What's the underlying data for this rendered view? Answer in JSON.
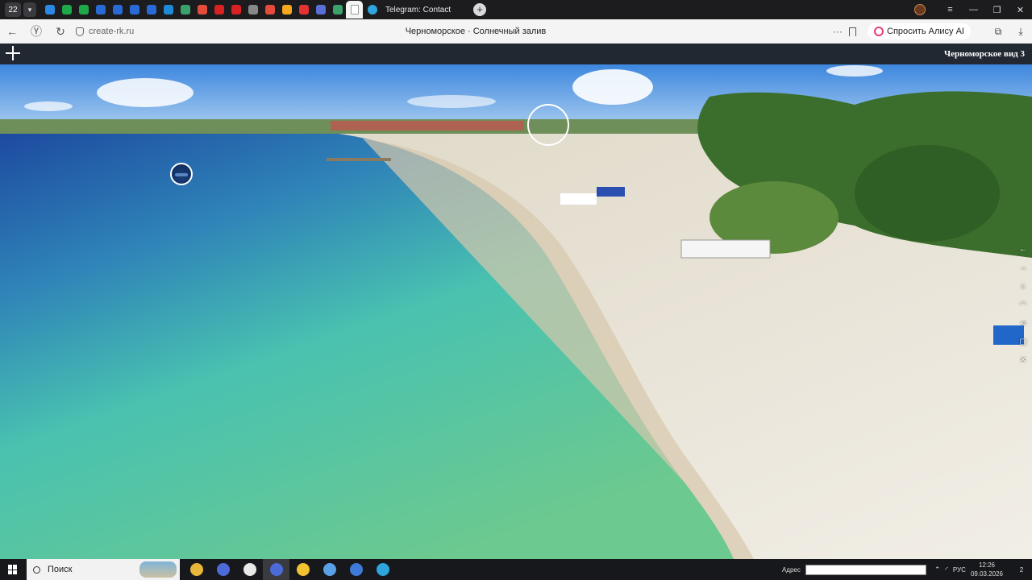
{
  "browser": {
    "tab_count": "22",
    "telegram_tab": "Telegram: Contact",
    "url": "create-rk.ru",
    "page_title": "Черноморское · Солнечный залив",
    "alice_button": "Спросить Алису AI"
  },
  "tab_icon_colors": [
    "#2b88e6",
    "#1fa84a",
    "#1fa84a",
    "#2a6ad6",
    "#2a6ad6",
    "#2a6ad6",
    "#2a6ad6",
    "#1e8ad6",
    "#3aa36b",
    "#e34b3b",
    "#d82222",
    "#d82222",
    "#888888",
    "#e34b3b",
    "#f6a81c",
    "#e33333",
    "#5b6dd6",
    "#3aa36b"
  ],
  "panorama": {
    "scene_name": "Черноморское вид 3"
  },
  "taskbar": {
    "search_placeholder": "Поиск",
    "address_label": "Адрес",
    "language": "РУС",
    "time": "12:26",
    "date": "09.03.2026",
    "notifications": "2"
  },
  "taskbar_app_colors": [
    "#e8b73a",
    "#4c6bd8",
    "#e8e8e8",
    "#4c6bd8",
    "#f2c230",
    "#5aa0e6",
    "#3e7bd8",
    "#2ea6dd"
  ],
  "colors": {
    "sea_deep": "#1d4aa0",
    "sea_shallow": "#49c2b0",
    "sand": "#eceae0",
    "chrome": "#1c1c1f"
  }
}
